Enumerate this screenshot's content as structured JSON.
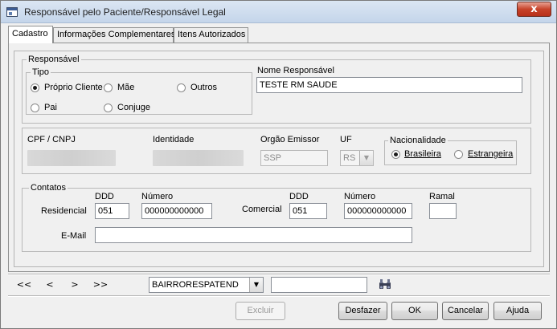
{
  "window": {
    "title": "Responsável pelo Paciente/Responsável Legal",
    "close_label": "x"
  },
  "tabs": [
    {
      "label": "Cadastro",
      "active": true
    },
    {
      "label": "Informações Complementares",
      "active": false
    },
    {
      "label": "Itens Autorizados",
      "active": false
    }
  ],
  "responsavel": {
    "group_label": "Responsável",
    "tipo": {
      "group_label": "Tipo",
      "options": [
        "Próprio Cliente",
        "Mãe",
        "Outros",
        "Pai",
        "Conjuge"
      ],
      "selected": "Próprio Cliente"
    },
    "nome_label": "Nome Responsável",
    "nome_value": "TESTE RM SAUDE"
  },
  "documento": {
    "cpf_label": "CPF / CNPJ",
    "identidade_label": "Identidade",
    "orgao_label": "Orgão Emissor",
    "orgao_value": "SSP",
    "uf_label": "UF",
    "uf_value": "RS",
    "nacionalidade": {
      "group_label": "Nacionalidade",
      "options": [
        "Brasileira",
        "Estrangeira"
      ],
      "selected": "Brasileira"
    }
  },
  "contatos": {
    "group_label": "Contatos",
    "ddd_label": "DDD",
    "numero_label": "Número",
    "ramal_label": "Ramal",
    "residencial_label": "Residencial",
    "residencial_ddd": "051",
    "residencial_numero": "000000000000",
    "comercial_label": "Comercial",
    "comercial_ddd": "051",
    "comercial_numero": "000000000000",
    "ramal_value": "",
    "email_label": "E-Mail",
    "email_value": ""
  },
  "navigation": {
    "first": "<<",
    "prev": "<",
    "next": ">",
    "last": ">>",
    "search_field": "BAIRRORESPATEND",
    "search_value": ""
  },
  "buttons": {
    "excluir": "Excluir",
    "desfazer": "Desfazer",
    "ok": "OK",
    "cancelar": "Cancelar",
    "ajuda": "Ajuda"
  }
}
